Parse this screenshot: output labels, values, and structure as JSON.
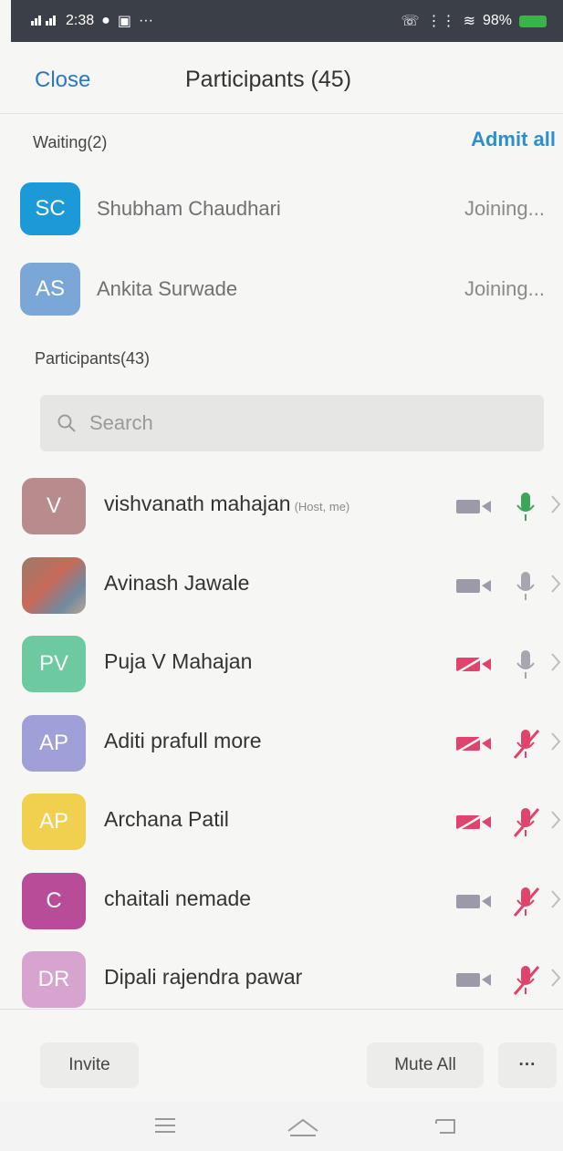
{
  "status_bar": {
    "time": "2:38",
    "battery_percent": "98%"
  },
  "header": {
    "close_label": "Close",
    "title": "Participants (45)"
  },
  "waiting": {
    "label": "Waiting(2)",
    "admit_all_label": "Admit all",
    "people": [
      {
        "initials": "SC",
        "name": "Shubham Chaudhari",
        "status": "Joining...",
        "color": "#1c9ad8"
      },
      {
        "initials": "AS",
        "name": "Ankita Surwade",
        "status": "Joining...",
        "color": "#7aa7d6"
      }
    ]
  },
  "participants": {
    "label": "Participants(43)",
    "search_placeholder": "Search",
    "list": [
      {
        "initials": "V",
        "name": "vishvanath mahajan",
        "tag": "(Host, me)",
        "color": "#b88c8c",
        "video_off": false,
        "mic_state": "active",
        "icon": "host-avatar"
      },
      {
        "initials": "",
        "name": "Avinash Jawale",
        "tag": "",
        "color": "#a07a6a",
        "video_off": false,
        "mic_state": "on",
        "icon": "photo-avatar"
      },
      {
        "initials": "PV",
        "name": "Puja V Mahajan",
        "tag": "",
        "color": "#6cc9a0",
        "video_off": true,
        "mic_state": "on"
      },
      {
        "initials": "AP",
        "name": "Aditi prafull more",
        "tag": "",
        "color": "#9fa0d8",
        "video_off": true,
        "mic_state": "muted"
      },
      {
        "initials": "AP",
        "name": "Archana Patil",
        "tag": "",
        "color": "#f1cf4f",
        "video_off": true,
        "mic_state": "muted"
      },
      {
        "initials": "C",
        "name": "chaitali nemade",
        "tag": "",
        "color": "#b84c98",
        "video_off": false,
        "mic_state": "muted"
      },
      {
        "initials": "DR",
        "name": "Dipali rajendra pawar",
        "tag": "",
        "color": "#d7a4cf",
        "video_off": false,
        "mic_state": "muted"
      }
    ]
  },
  "footer": {
    "invite_label": "Invite",
    "mute_all_label": "Mute All",
    "more_label": "···"
  },
  "colors": {
    "accent_blue": "#2b77c7",
    "muted_red": "#e0436b",
    "mic_green": "#3aa657"
  }
}
